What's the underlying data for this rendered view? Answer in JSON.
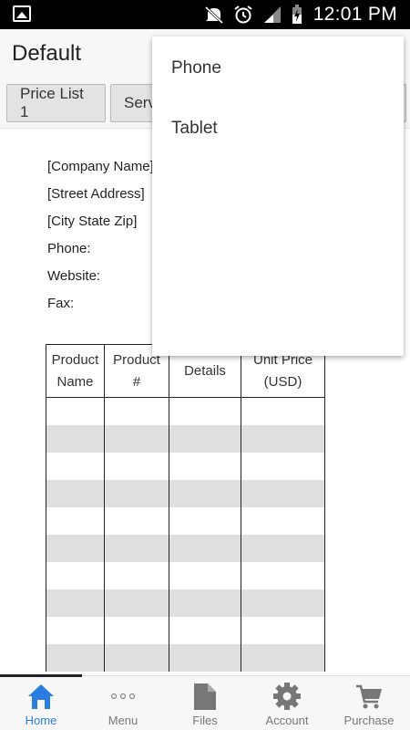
{
  "status_bar": {
    "time": "12:01 PM",
    "icons": [
      "gallery-icon",
      "mute-icon",
      "alarm-icon",
      "signal-icon",
      "battery-charging-icon"
    ]
  },
  "app_bar": {
    "title": "Default"
  },
  "tabs": [
    {
      "label": "Price List 1"
    },
    {
      "label": "Serv"
    }
  ],
  "document": {
    "address_lines": [
      "[Company Name]",
      "[Street Address]",
      "[City State Zip]",
      "Phone:",
      "Website:",
      "Fax:"
    ],
    "table_headers": [
      [
        "Product",
        "Name"
      ],
      [
        "Product",
        "#"
      ],
      [
        "Details"
      ],
      [
        "Unit Price",
        "(USD)"
      ]
    ],
    "empty_rows": 10
  },
  "dropdown": {
    "items": [
      "Phone",
      "Tablet"
    ]
  },
  "bottom_nav": {
    "items": [
      {
        "label": "Home",
        "icon": "home-icon",
        "active": true
      },
      {
        "label": "Menu",
        "icon": "dots-icon",
        "active": false
      },
      {
        "label": "Files",
        "icon": "file-icon",
        "active": false
      },
      {
        "label": "Account",
        "icon": "gear-icon",
        "active": false
      },
      {
        "label": "Purchase",
        "icon": "cart-icon",
        "active": false
      }
    ],
    "active_color": "#2a7de1",
    "inactive_color": "#777777"
  }
}
